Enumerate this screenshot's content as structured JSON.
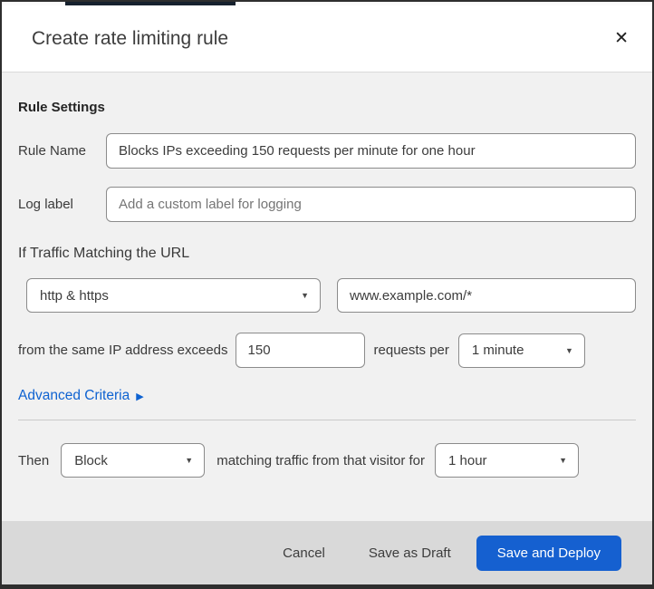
{
  "modal": {
    "title": "Create rate limiting rule"
  },
  "icons": {
    "close": "✕",
    "caret_down": "▼",
    "arrow_right": "▶"
  },
  "colors": {
    "primary_button_blue": "#1560d0",
    "link_blue": "#0e62d1",
    "body_gray": "#f1f1f1",
    "footer_gray": "#d9d9d9",
    "navy_strip": "#16212e"
  },
  "rule_settings": {
    "heading": "Rule Settings",
    "rule_name": {
      "label": "Rule Name",
      "value": "Blocks IPs exceeding 150 requests per minute for one hour"
    },
    "log_label": {
      "label": "Log label",
      "placeholder": "Add a custom label for logging"
    }
  },
  "criteria": {
    "heading": "If Traffic Matching the URL",
    "scheme_select_value": "http & https",
    "url_value": "www.example.com/*",
    "rate_prefix": "from the same IP address exceeds",
    "threshold_value": "150",
    "rate_middle": "requests per",
    "period_select_value": "1 minute",
    "advanced_link": "Advanced Criteria"
  },
  "action": {
    "then_label": "Then",
    "action_select_value": "Block",
    "duration_text": "matching traffic from that visitor for",
    "duration_select_value": "1 hour"
  },
  "footer": {
    "cancel_label": "Cancel",
    "save_draft_label": "Save as Draft",
    "save_deploy_label": "Save and Deploy"
  }
}
